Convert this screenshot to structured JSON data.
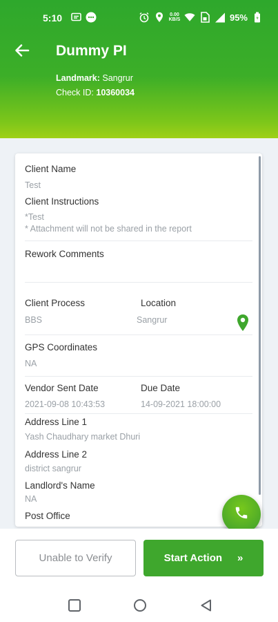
{
  "status_bar": {
    "time": "5:10",
    "battery_percent": "95%",
    "data_speed": "0.00 KB/S",
    "icons_left": [
      "sms-icon",
      "messenger-icon"
    ],
    "icons_right": [
      "alarm-icon",
      "location-icon",
      "data-speed-icon",
      "wifi-icon",
      "sim-icon",
      "signal-icon",
      "battery-icon"
    ]
  },
  "header": {
    "title": "Dummy PI",
    "landmark_label": "Landmark:",
    "landmark_value": "Sangrur",
    "check_id_label": "Check ID:",
    "check_id_value": "10360034"
  },
  "fields": {
    "client_name": {
      "label": "Client Name",
      "value": "Test"
    },
    "client_instructions": {
      "label": "Client Instructions",
      "value_line1": "*Test",
      "value_line2": "* Attachment will not be shared in the report"
    },
    "rework_comments": {
      "label": "Rework Comments",
      "value": ""
    },
    "client_process": {
      "label": "Client Process",
      "value": "BBS"
    },
    "location": {
      "label": "Location",
      "value": "Sangrur"
    },
    "gps_coordinates": {
      "label": "GPS Coordinates",
      "value": "NA"
    },
    "vendor_sent_date": {
      "label": "Vendor Sent Date",
      "value": "2021-09-08 10:43:53"
    },
    "due_date": {
      "label": "Due Date",
      "value": "14-09-2021 18:00:00"
    },
    "address_line_1": {
      "label": "Address Line 1",
      "value": "Yash Chaudhary market Dhuri"
    },
    "address_line_2": {
      "label": "Address Line 2",
      "value": "district sangrur"
    },
    "landlord_name": {
      "label": "Landlord's Name",
      "value": "NA"
    },
    "post_office": {
      "label": "Post Office"
    }
  },
  "actions": {
    "unable_label": "Unable to Verify",
    "start_label": "Start Action",
    "start_chevron": "»"
  },
  "colors": {
    "brand_green": "#3fa72d",
    "header_gradient_end": "#9fd018",
    "content_bg": "#eef2f6"
  }
}
